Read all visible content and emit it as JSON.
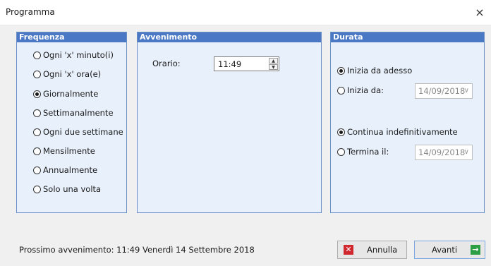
{
  "window": {
    "title": "Programma",
    "close_glyph": "×"
  },
  "frequency": {
    "header": "Frequenza",
    "options": [
      {
        "label": "Ogni 'x' minuto(i)",
        "selected": false
      },
      {
        "label": "Ogni 'x' ora(e)",
        "selected": false
      },
      {
        "label": "Giornalmente",
        "selected": true
      },
      {
        "label": "Settimanalmente",
        "selected": false
      },
      {
        "label": "Ogni due settimane",
        "selected": false
      },
      {
        "label": "Mensilmente",
        "selected": false
      },
      {
        "label": "Annualmente",
        "selected": false
      },
      {
        "label": "Solo una volta",
        "selected": false
      }
    ]
  },
  "occurrence": {
    "header": "Avvenimento",
    "time_label": "Orario:",
    "time_value": "11:49"
  },
  "duration": {
    "header": "Durata",
    "start_now": {
      "label": "Inizia da adesso",
      "selected": true
    },
    "start_from": {
      "label": "Inizia da:",
      "selected": false,
      "date": "14/09/2018"
    },
    "continue_forever": {
      "label": "Continua indefinitivamente",
      "selected": true
    },
    "end_on": {
      "label": "Termina il:",
      "selected": false,
      "date": "14/09/2018"
    }
  },
  "footer": {
    "status": "Prossimo avvenimento: 11:49 Venerdì 14 Settembre 2018",
    "cancel_label": "Annulla",
    "next_label": "Avanti"
  },
  "icons": {
    "cancel": "close-x-icon",
    "next": "arrow-right-icon",
    "dropdown": "chevron-down-icon"
  },
  "colors": {
    "group_header": "#4a78c4",
    "group_bg": "#e8f0fb",
    "cancel_icon": "#d0262e",
    "next_icon": "#2c9e43"
  }
}
